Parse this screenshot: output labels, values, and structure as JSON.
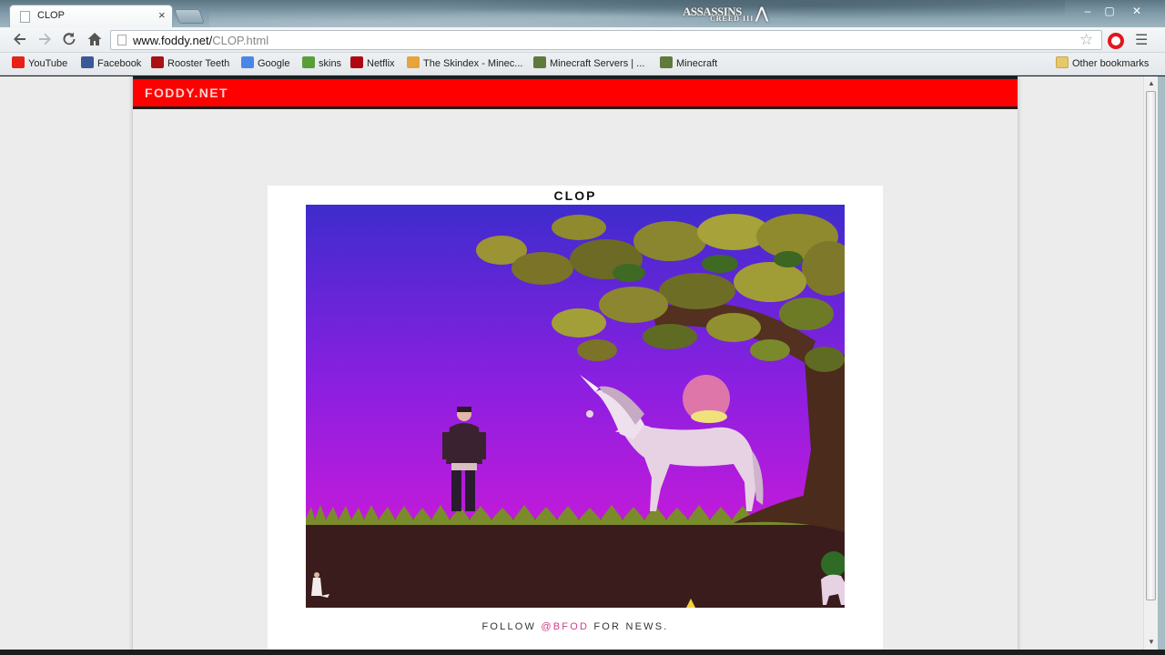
{
  "window": {
    "tab_title": "CLOP",
    "tab_close": "×",
    "brand_logo_text": "ASSASSINS",
    "brand_logo_sub": "CREED III",
    "controls": {
      "minimize": "–",
      "maximize": "▢",
      "close": "✕"
    }
  },
  "toolbar": {
    "url_host": "www.foddy.net/",
    "url_path": "CLOP.html"
  },
  "bookmarks": [
    {
      "label": "YouTube",
      "icon": "youtube-icon",
      "color": "#e62117"
    },
    {
      "label": "Facebook",
      "icon": "facebook-icon",
      "color": "#3b5998"
    },
    {
      "label": "Rooster Teeth",
      "icon": "rooster-teeth-icon",
      "color": "#a11"
    },
    {
      "label": "Google",
      "icon": "google-icon",
      "color": "#4a86e8"
    },
    {
      "label": "skins",
      "icon": "chrome-icon",
      "color": "#5a9e3a"
    },
    {
      "label": "Netflix",
      "icon": "netflix-icon",
      "color": "#b00610"
    },
    {
      "label": "The Skindex - Minec...",
      "icon": "skindex-icon",
      "color": "#e8a33a"
    },
    {
      "label": "Minecraft Servers | ...",
      "icon": "minecraft-block-icon",
      "color": "#5f7a3a"
    },
    {
      "label": "Minecraft",
      "icon": "minecraft-block-icon",
      "color": "#5f7a3a"
    }
  ],
  "other_bookmarks": "Other bookmarks",
  "site": {
    "logo": "FODDY.NET",
    "accent_color": "#ff0000"
  },
  "game": {
    "title": "CLOP",
    "follow_prefix": "FOLLOW ",
    "follow_handle": "@BFOD",
    "follow_suffix": " FOR NEWS."
  }
}
